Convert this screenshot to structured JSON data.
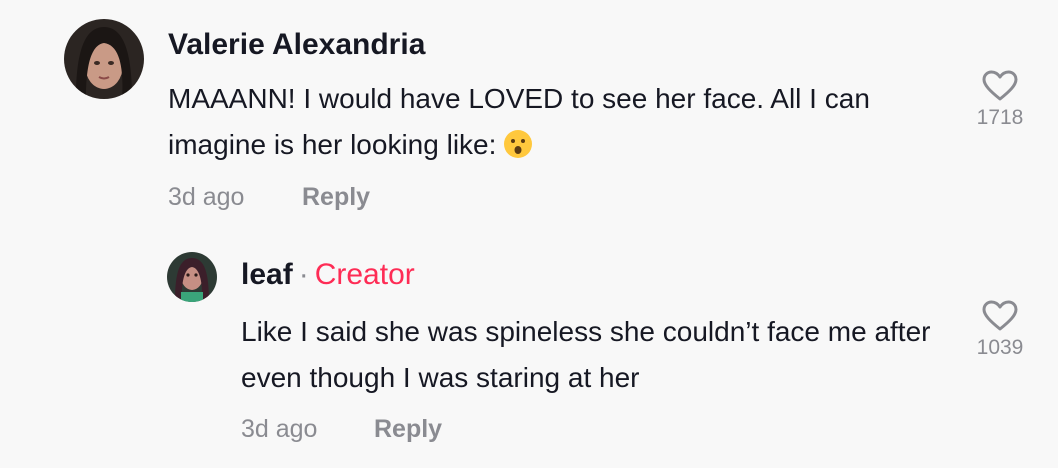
{
  "comments": [
    {
      "username": "Valerie Alexandria",
      "text": "MAAANN! I would have LOVED to see her face. All I can imagine is her looking like:",
      "text_emoji": "face-with-open-mouth-emoji",
      "time": "3d ago",
      "reply_label": "Reply",
      "likes": "1718"
    }
  ],
  "replies": [
    {
      "username": "leaf",
      "separator": "·",
      "badge": "Creator",
      "text": "Like I said she was spineless she couldn’t face me after even though I was staring at her",
      "time": "3d ago",
      "reply_label": "Reply",
      "likes": "1039"
    }
  ],
  "colors": {
    "background": "#f8f8f8",
    "text": "#161823",
    "muted": "#8a8b91",
    "creator": "#fe2c55"
  },
  "icons": {
    "like": "heart-outline-icon"
  }
}
